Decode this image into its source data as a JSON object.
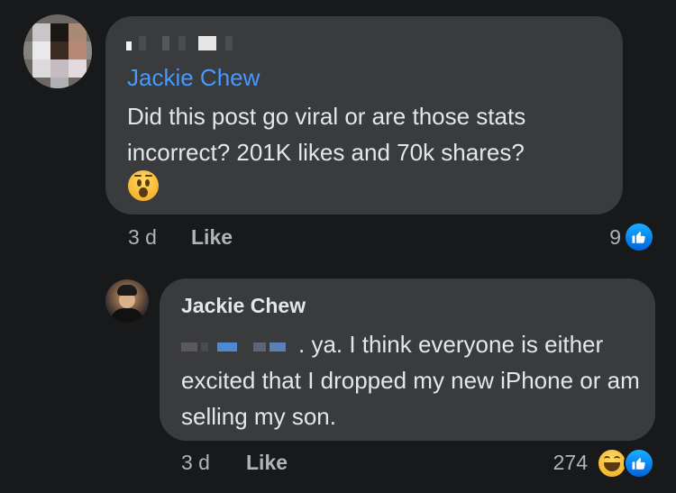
{
  "comment": {
    "mention": "Jackie Chew",
    "text": "Did this post go viral or are those stats incorrect? 201K likes and 70k shares?",
    "emoji": "hushed-face",
    "time": "3 d",
    "like_label": "Like",
    "reaction_count": "9",
    "reactions": [
      "like"
    ]
  },
  "reply": {
    "author": "Jackie Chew",
    "text": ". ya. I think everyone is either excited that I dropped my new iPhone or am selling my son.",
    "time": "3 d",
    "like_label": "Like",
    "reaction_count": "274",
    "reactions": [
      "haha",
      "like"
    ]
  },
  "colors": {
    "background": "#18191a",
    "bubble": "#3a3b3c",
    "mention": "#4599ff",
    "meta_text": "#b0b3b8",
    "primary_text": "#e4e6eb"
  }
}
